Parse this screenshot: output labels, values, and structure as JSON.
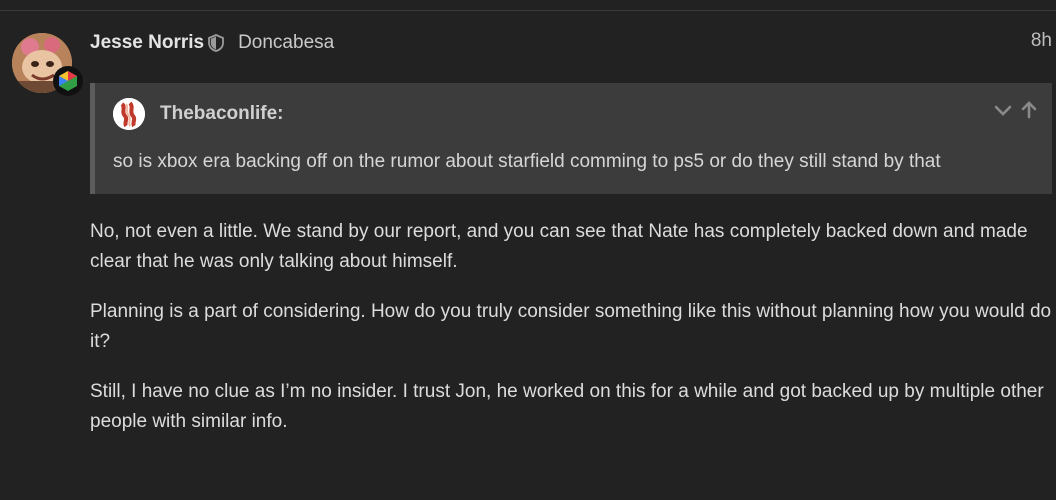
{
  "post": {
    "username": "Jesse Norris",
    "full_name": "Doncabesa",
    "date": "8h"
  },
  "quote": {
    "username": "Thebaconlife:",
    "text": "so is xbox era backing off on the rumor about starfield comming to ps5 or do they still stand by that"
  },
  "body": {
    "paragraphs": [
      "No, not even a little. We stand by our report, and you can see that Nate has completely backed down and made clear that he was only talking about himself.",
      "Planning is a part of considering. How do you truly consider something like this without planning how you would do it?",
      "Still, I have no clue as I’m no insider. I trust Jon, he worked on this for a while and got backed up by multiple other people with similar info."
    ]
  },
  "icons": {
    "moderator": "shield-icon",
    "expand": "chevron-down-icon",
    "jump": "arrow-up-icon"
  }
}
